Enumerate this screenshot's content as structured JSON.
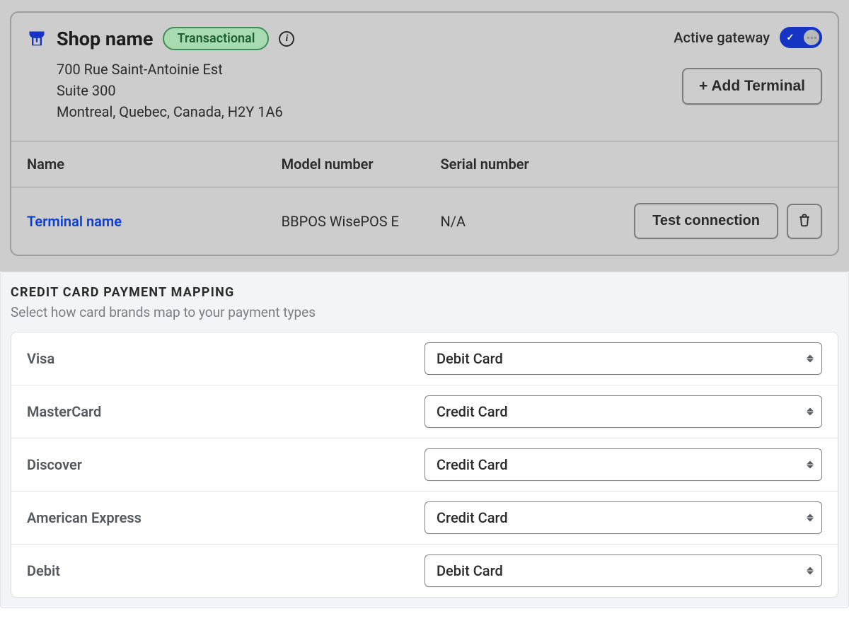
{
  "shop": {
    "name": "Shop name",
    "badge_label": "Transactional",
    "address_line1": "700 Rue Saint-Antoinie Est",
    "address_line2": "Suite 300",
    "address_line3": "Montreal, Quebec, Canada, H2Y 1A6",
    "active_gateway_label": "Active gateway",
    "add_terminal_label": "+ Add Terminal"
  },
  "terminals": {
    "columns": {
      "name": "Name",
      "model": "Model number",
      "serial": "Serial number"
    },
    "rows": [
      {
        "name": "Terminal name",
        "model": "BBPOS WisePOS E",
        "serial": "N/A"
      }
    ],
    "test_connection_label": "Test connection"
  },
  "mapping": {
    "title": "Credit Card Payment Mapping",
    "subtitle": "Select how card brands map to your payment types",
    "rows": [
      {
        "brand": "Visa",
        "value": "Debit Card"
      },
      {
        "brand": "MasterCard",
        "value": "Credit Card"
      },
      {
        "brand": "Discover",
        "value": "Credit Card"
      },
      {
        "brand": "American Express",
        "value": "Credit Card"
      },
      {
        "brand": "Debit",
        "value": "Debit Card"
      }
    ]
  }
}
